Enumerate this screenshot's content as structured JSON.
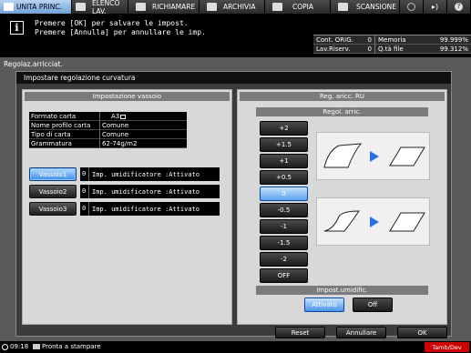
{
  "tabs": [
    {
      "label": "UNITA PRINC.",
      "icon": "machine-icon",
      "active": true
    },
    {
      "label": "ELENCO LAV.",
      "icon": "job-list-icon",
      "active": false
    },
    {
      "label": "RICHIAMARE",
      "icon": "recall-icon",
      "active": false
    },
    {
      "label": "ARCHIVIA",
      "icon": "archive-icon",
      "active": false
    },
    {
      "label": "COPIA",
      "icon": "copy-icon",
      "active": false
    },
    {
      "label": "SCANSIONE",
      "icon": "scan-icon",
      "active": false
    }
  ],
  "message": {
    "line1": "Premere [OK] per salvare le impost.",
    "line2": "Premere [Annulla] per annullare le imp."
  },
  "status": {
    "cont_orig_label": "Cont. ORIG.",
    "cont_orig_value": "0",
    "memoria_label": "Memoria",
    "memoria_value": "99.999%",
    "lav_riserv_label": "Lav.Riserv.",
    "lav_riserv_value": "0",
    "qta_file_label": "Q.tà file",
    "qta_file_value": "99.312%"
  },
  "screen_title": "Regolaz.arricciat.",
  "dialog_title": "Impostare regolazione curvatura",
  "left_panel": {
    "header": "Impostazione vassoio",
    "paper_info": [
      {
        "label": "Formato carta",
        "value": "A3"
      },
      {
        "label": "Nome profilo carta",
        "value": "Comune"
      },
      {
        "label": "Tipo di carta",
        "value": "Comune"
      },
      {
        "label": "Grammatura",
        "value": "62-74g/m2"
      }
    ],
    "trays": [
      {
        "label": "Vassoio1",
        "num": "0",
        "info": "Imp. umidificatore  :Attivato",
        "selected": true
      },
      {
        "label": "Vassoio2",
        "num": "0",
        "info": "Imp. umidificatore  :Attivato",
        "selected": false
      },
      {
        "label": "Vassoio3",
        "num": "0",
        "info": "Imp. umidificatore  :Attivato",
        "selected": false
      }
    ]
  },
  "right_panel": {
    "header": "Reg. aricc. RU",
    "subheader": "Regol. arric.",
    "levels": [
      "+2",
      "+1.5",
      "+1",
      "+0.5",
      "0",
      "-0.5",
      "-1",
      "-1.5",
      "-2",
      "OFF"
    ],
    "selected_level": "0",
    "humidifier_header": "Impost.umidific.",
    "on_label": "Attivato",
    "off_label": "Off",
    "humidifier_on": true
  },
  "buttons": {
    "reset": "Reset",
    "cancel": "Annullare",
    "ok": "OK"
  },
  "statusbar": {
    "time": "09:18",
    "status_text": "Pronta a stampare",
    "toner_text": "Tamb/Dev"
  },
  "colors": {
    "selected_blue": "#4a92e8",
    "arrow_blue": "#2a6fe0",
    "toner_red": "#cc0000"
  }
}
